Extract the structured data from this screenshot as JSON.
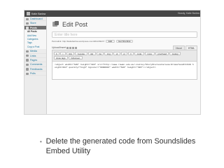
{
  "admin_bar": {
    "site_name": "Katie Barlow",
    "howdy": "Howdy, Katie Barlow"
  },
  "sidebar": {
    "items": [
      {
        "label": "Dashboard",
        "active": false
      },
      {
        "label": "Store",
        "active": false
      },
      {
        "label": "Posts",
        "active": true
      },
      {
        "label": "Media",
        "active": false
      },
      {
        "label": "Links",
        "active": false
      },
      {
        "label": "Pages",
        "active": false
      },
      {
        "label": "Comments",
        "active": false
      },
      {
        "label": "Feedbacks",
        "active": false
      },
      {
        "label": "Polls",
        "active": false
      }
    ],
    "posts_submenu": [
      "All Posts",
      "Add New",
      "Categories",
      "Tags",
      "Copy a Post"
    ]
  },
  "main": {
    "page_title": "Edit Post",
    "title_placeholder": "Enter title here",
    "permalink": {
      "label": "Permalink:",
      "url": "http://katiebarlow.wordpress.com/2011/09/27/",
      "edit_label": "Edit",
      "get_shortlink_label": "Get Shortlink"
    },
    "upload_insert_label": "Upload/Insert",
    "tabs": [
      "Visual",
      "HTML"
    ],
    "active_tab": "HTML",
    "quicktags": [
      "b",
      "i",
      "link",
      "b-quote",
      "del",
      "ins",
      "img",
      "ul",
      "ol",
      "li",
      "code",
      "more",
      "proofread",
      "lookup",
      "close tags",
      "fullscreen"
    ],
    "editor_content": "<object width=\"620\" height=\"383\" src=\"http://www.rowan.edu.au/~keiley/StoryStoriesCarouselFrame?width=620 height=384\" quality=\"high\" bgcolor=\"#000000\" width=\"620\" height=\"383\"></object>"
  },
  "bullet": {
    "text": "Delete the generated code from Soundslides Embed Utility"
  }
}
